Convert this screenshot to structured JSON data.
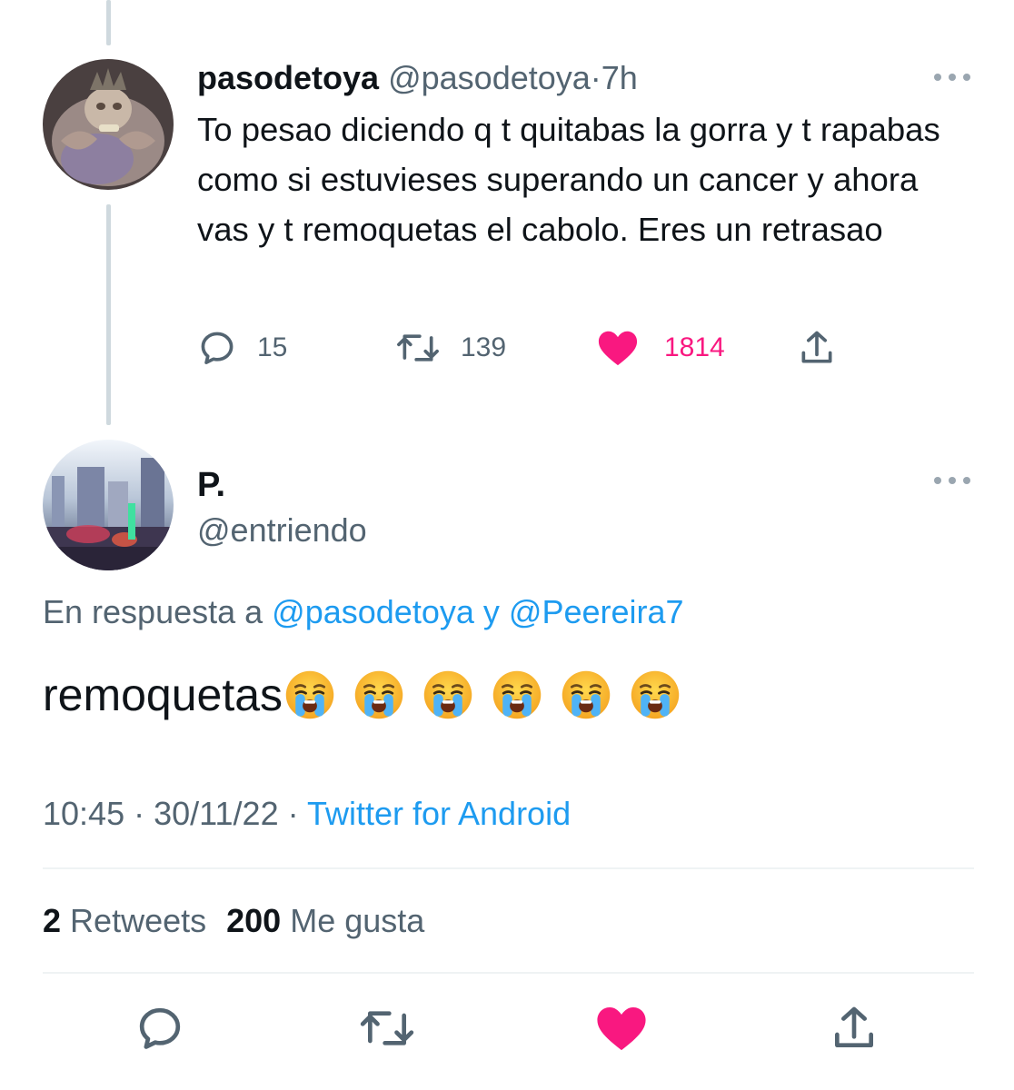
{
  "parent_tweet": {
    "name": "pasodetoya",
    "handle": "@pasodetoya",
    "separator": "·",
    "time": "7h",
    "text": "To pesao diciendo q t quitabas la gorra y t rapabas como si estuvieses superando un cancer y ahora vas y t remoquetas el cabolo. Eres un retrasao",
    "replies": "15",
    "retweets": "139",
    "likes": "1814",
    "liked": true
  },
  "main_tweet": {
    "name": "P.",
    "handle": "@entriendo",
    "reply_prefix": "En respuesta a",
    "reply_user1": "@pasodetoya",
    "reply_conj": "y",
    "reply_user2": "@Peereira7",
    "text": "remoquetas",
    "emoji_count_crying": 6,
    "time": "10:45",
    "date": "30/11/22",
    "separator": "·",
    "source": "Twitter for Android",
    "retweet_count": "2",
    "retweet_label": "Retweets",
    "like_count": "200",
    "like_label": "Me gusta"
  },
  "icons": {
    "reply": "reply-icon",
    "retweet": "retweet-icon",
    "like": "heart-icon",
    "share": "share-icon",
    "more": "more-icon"
  },
  "colors": {
    "text_primary": "#0f1419",
    "text_secondary": "#536471",
    "link": "#1d9bf0",
    "like": "#f91880",
    "thread_line": "#cfd9de",
    "divider": "#eff3f4"
  }
}
